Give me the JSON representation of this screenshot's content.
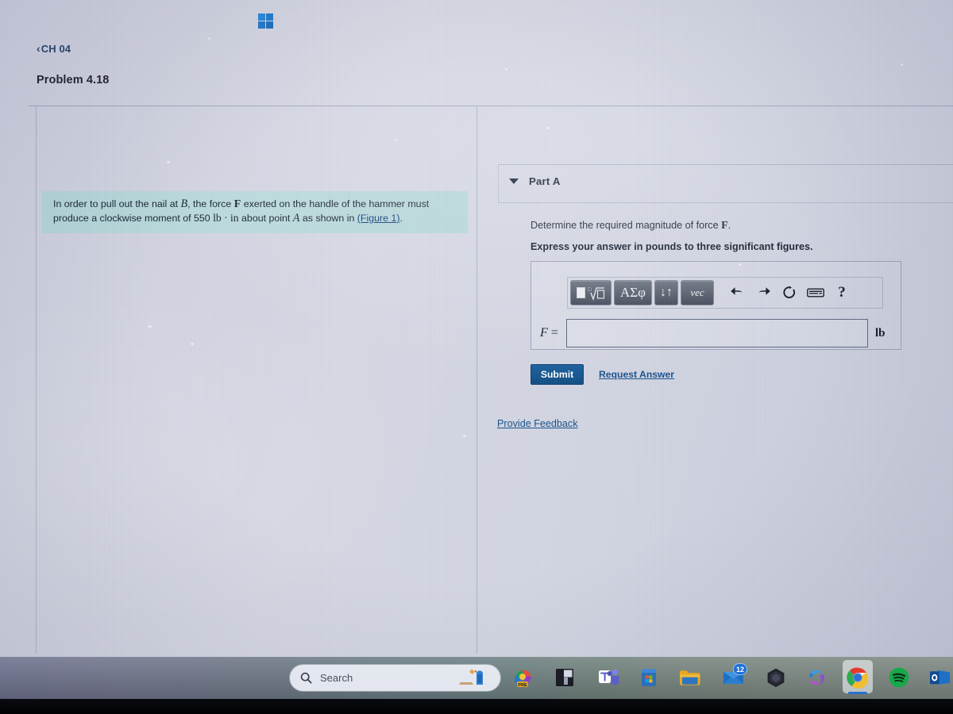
{
  "header": {
    "breadcrumb_chevron": "‹",
    "breadcrumb_label": "CH 04",
    "page_title": "Problem 4.18"
  },
  "problem": {
    "text_1": "In order to pull out the nail at ",
    "var_B": "B",
    "text_2": ", the force ",
    "var_F": "F",
    "text_3": " exerted on the handle of the hammer must produce a clockwise moment of 550 ",
    "unit_lbin": "lb · in",
    "text_4": " about point ",
    "var_A": "A",
    "text_5": " as shown in ",
    "figure_link": "(Figure 1)",
    "text_6": "."
  },
  "part": {
    "caret_icon": "caret-down-icon",
    "label": "Part A",
    "prompt_text": "Determine the required magnitude of force ",
    "prompt_var": "F",
    "prompt_period": ".",
    "instruction": "Express your answer in pounds to three significant figures."
  },
  "mathbar": {
    "buttons": [
      {
        "name": "math-templates-button",
        "label": "",
        "icon": "square-nth-root-icon"
      },
      {
        "name": "greek-symbols-button",
        "label": "ΑΣφ",
        "icon": "greek-letters-icon"
      },
      {
        "name": "more-templates-button",
        "label": "↓↑",
        "icon": "up-down-arrows-icon"
      },
      {
        "name": "vector-button",
        "label": "vec",
        "icon": "vector-icon"
      }
    ],
    "tools": [
      {
        "name": "undo-button",
        "icon": "undo-arrow-icon"
      },
      {
        "name": "redo-button",
        "icon": "redo-arrow-icon"
      },
      {
        "name": "reset-button",
        "icon": "refresh-circle-icon"
      },
      {
        "name": "keyboard-button",
        "icon": "keyboard-icon"
      },
      {
        "name": "help-button",
        "icon": "question-mark-icon",
        "label": "?"
      }
    ]
  },
  "answer": {
    "field_label_var": "F",
    "field_label_eq": " =",
    "value": "",
    "placeholder": "",
    "unit": "lb"
  },
  "actions": {
    "submit_label": "Submit",
    "request_answer_label": "Request Answer",
    "provide_feedback_label": "Provide Feedback"
  },
  "colors": {
    "submit_blue": "#14558f",
    "link_blue": "#17518c",
    "callout_teal": "#b6d7da",
    "breadcrumb_blue": "#1d3f66"
  },
  "taskbar": {
    "start_icon": "windows-logo-icon",
    "search_placeholder": "Search",
    "search_icon": "search-icon",
    "items": [
      {
        "name": "taskbar-widgets-icon",
        "icon": "pen-notepad-icon",
        "badge": ""
      },
      {
        "name": "taskbar-copilot-pro-icon",
        "icon": "copilot-pre-icon",
        "badge": "",
        "sub_label": "PRE"
      },
      {
        "name": "taskbar-app-dark-icon",
        "icon": "dark-square-app-icon",
        "badge": ""
      },
      {
        "name": "taskbar-teams-icon",
        "icon": "microsoft-teams-icon",
        "badge": ""
      },
      {
        "name": "taskbar-store-icon",
        "icon": "microsoft-store-icon",
        "badge": ""
      },
      {
        "name": "taskbar-file-explorer-icon",
        "icon": "folder-icon",
        "badge": ""
      },
      {
        "name": "taskbar-mail-icon",
        "icon": "mail-envelope-icon",
        "badge": "12"
      },
      {
        "name": "taskbar-hexagon-icon",
        "icon": "dark-hexagon-icon",
        "badge": ""
      },
      {
        "name": "taskbar-copilot-icon",
        "icon": "copilot-swirl-icon",
        "badge": ""
      },
      {
        "name": "taskbar-chrome-icon",
        "icon": "google-chrome-icon",
        "badge": ""
      },
      {
        "name": "taskbar-spotify-icon",
        "icon": "spotify-icon",
        "badge": ""
      },
      {
        "name": "taskbar-outlook-icon",
        "icon": "outlook-icon",
        "badge": ""
      }
    ]
  }
}
